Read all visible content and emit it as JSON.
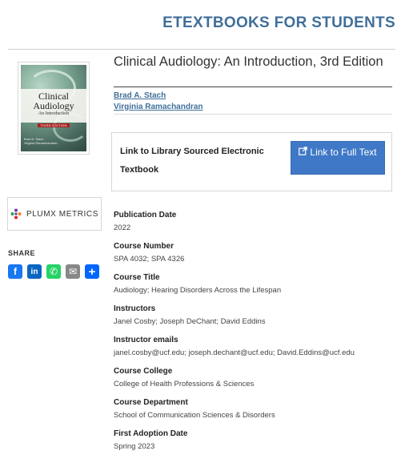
{
  "site": {
    "title": "ETEXTBOOKS FOR STUDENTS"
  },
  "book": {
    "title": "Clinical Audiology: An Introduction, 3rd Edition",
    "authors": [
      "Brad A. Stach",
      "Virginia Ramachandran"
    ],
    "cover": {
      "title_line1": "Clinical",
      "title_line2": "Audiology",
      "subtitle": "An Introduction",
      "edition": "THIRD EDITION",
      "authors_line1": "Brad A. Stach",
      "authors_line2": "Virginia Ramachandran"
    }
  },
  "library_link": {
    "label": "Link to Library Sourced Electronic Textbook",
    "button_label": "Link to Full Text",
    "button_color": "#3f78c7"
  },
  "plumx": {
    "label": "PLUMX METRICS"
  },
  "share": {
    "label": "SHARE",
    "icons": [
      {
        "name": "facebook-icon",
        "glyph": "f",
        "color": "#1877f2"
      },
      {
        "name": "linkedin-icon",
        "glyph": "in",
        "color": "#0a66c2"
      },
      {
        "name": "whatsapp-icon",
        "glyph": "✆",
        "color": "#25d366"
      },
      {
        "name": "email-icon",
        "glyph": "✉",
        "color": "#888888"
      },
      {
        "name": "more-share-icon",
        "glyph": "+",
        "color": "#0166ff"
      }
    ]
  },
  "metadata": [
    {
      "label": "Publication Date",
      "value": "2022"
    },
    {
      "label": "Course Number",
      "value": "SPA 4032; SPA 4326"
    },
    {
      "label": "Course Title",
      "value": "Audiology; Hearing Disorders Across the Lifespan"
    },
    {
      "label": "Instructors",
      "value": "Janel Cosby; Joseph DeChant; David Eddins"
    },
    {
      "label": "Instructor emails",
      "value": "janel.cosby@ucf.edu; joseph.dechant@ucf.edu; David.Eddins@ucf.edu"
    },
    {
      "label": "Course College",
      "value": "College of Health Professions & Sciences"
    },
    {
      "label": "Course Department",
      "value": "School of Communication Sciences & Disorders"
    },
    {
      "label": "First Adoption Date",
      "value": "Spring 2023"
    }
  ],
  "colors": {
    "accent": "#3f6f99"
  }
}
